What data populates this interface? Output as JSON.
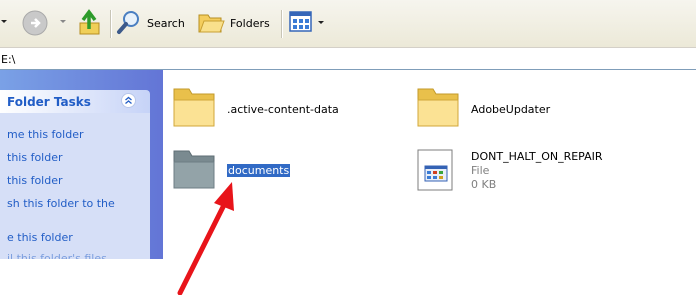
{
  "toolbar": {
    "search_label": "Search",
    "folders_label": "Folders",
    "back_icon": "back-arrow-icon",
    "up_icon": "folder-up-icon",
    "views_icon": "views-icon"
  },
  "address": {
    "value": "E:\\"
  },
  "left_pane": {
    "section_title": "Folder Tasks",
    "tasks": [
      "me this folder",
      "this folder",
      "this folder",
      "sh this folder to the",
      "e this folder",
      "il this folder's files"
    ]
  },
  "items": [
    {
      "name": ".active-content-data",
      "type": "folder"
    },
    {
      "name": "AdobeUpdater",
      "type": "folder"
    },
    {
      "name": "documents",
      "type": "folder",
      "selected": true,
      "state": "hidden"
    },
    {
      "name": "DONT_HALT_ON_REPAIR",
      "type": "file",
      "kind": "File",
      "size": "0 KB"
    }
  ],
  "colors": {
    "arrow": "#e8141a",
    "selection": "#316ac5",
    "link": "#215dc6"
  }
}
